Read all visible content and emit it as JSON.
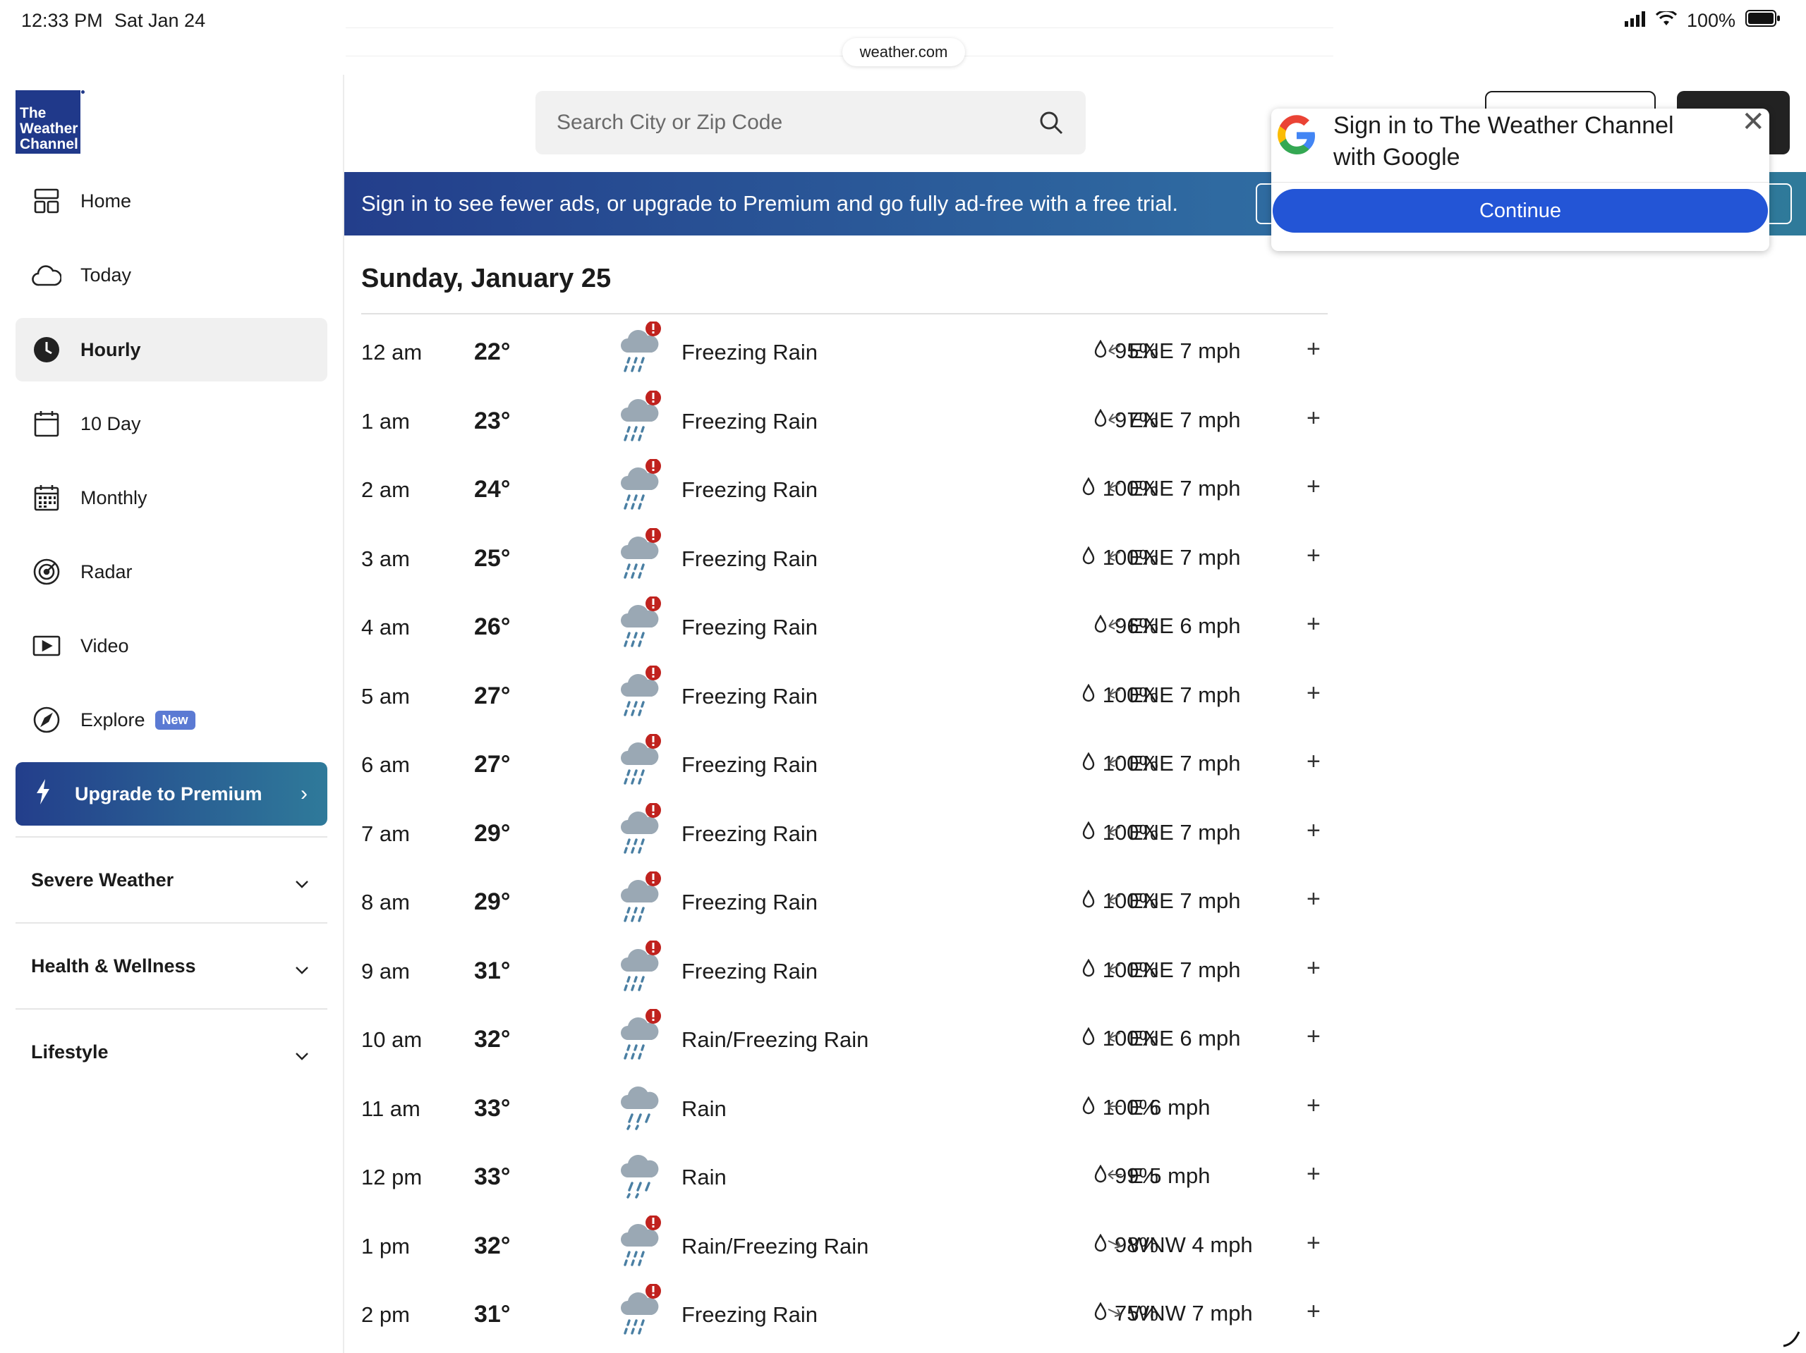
{
  "status_bar": {
    "time": "12:33 PM",
    "date": "Sat Jan 24",
    "battery": "100%"
  },
  "browser": {
    "url": "weather.com"
  },
  "logo": {
    "line1": "The",
    "line2": "Weather",
    "line3": "Channel"
  },
  "sidebar": {
    "items": [
      {
        "label": "Home",
        "icon": "home-grid-icon"
      },
      {
        "label": "Today",
        "icon": "cloud-icon"
      },
      {
        "label": "Hourly",
        "icon": "clock-icon",
        "active": true
      },
      {
        "label": "10 Day",
        "icon": "calendar-icon"
      },
      {
        "label": "Monthly",
        "icon": "calendar-grid-icon"
      },
      {
        "label": "Radar",
        "icon": "radar-icon"
      },
      {
        "label": "Video",
        "icon": "video-icon"
      },
      {
        "label": "Explore",
        "icon": "compass-icon",
        "badge": "New"
      }
    ],
    "premium_label": "Upgrade to Premium",
    "sections": [
      "Severe Weather",
      "Health & Wellness",
      "Lifestyle"
    ]
  },
  "header": {
    "search_placeholder": "Search City or Zip Code"
  },
  "banner": {
    "text": "Sign in to see fewer ads, or upgrade to Premium and go fully ad-free with a free trial."
  },
  "google_popup": {
    "title_line1": "Sign in to The Weather Channel",
    "title_line2": "with Google",
    "continue_label": "Continue"
  },
  "hourly": {
    "day": "Sunday, January 25",
    "rows": [
      {
        "time": "12 am",
        "temp": "22°",
        "condition": "Freezing Rain",
        "alert": true,
        "precip": "95%",
        "wind": "ENE 7 mph",
        "dir": "ene"
      },
      {
        "time": "1 am",
        "temp": "23°",
        "condition": "Freezing Rain",
        "alert": true,
        "precip": "97%",
        "wind": "ENE 7 mph",
        "dir": "ene"
      },
      {
        "time": "2 am",
        "temp": "24°",
        "condition": "Freezing Rain",
        "alert": true,
        "precip": "100%",
        "wind": "ENE 7 mph",
        "dir": "ene"
      },
      {
        "time": "3 am",
        "temp": "25°",
        "condition": "Freezing Rain",
        "alert": true,
        "precip": "100%",
        "wind": "ENE 7 mph",
        "dir": "ene"
      },
      {
        "time": "4 am",
        "temp": "26°",
        "condition": "Freezing Rain",
        "alert": true,
        "precip": "96%",
        "wind": "ENE 6 mph",
        "dir": "ene"
      },
      {
        "time": "5 am",
        "temp": "27°",
        "condition": "Freezing Rain",
        "alert": true,
        "precip": "100%",
        "wind": "ENE 7 mph",
        "dir": "ene"
      },
      {
        "time": "6 am",
        "temp": "27°",
        "condition": "Freezing Rain",
        "alert": true,
        "precip": "100%",
        "wind": "ENE 7 mph",
        "dir": "ene"
      },
      {
        "time": "7 am",
        "temp": "29°",
        "condition": "Freezing Rain",
        "alert": true,
        "precip": "100%",
        "wind": "ENE 7 mph",
        "dir": "ene"
      },
      {
        "time": "8 am",
        "temp": "29°",
        "condition": "Freezing Rain",
        "alert": true,
        "precip": "100%",
        "wind": "ENE 7 mph",
        "dir": "ene"
      },
      {
        "time": "9 am",
        "temp": "31°",
        "condition": "Freezing Rain",
        "alert": true,
        "precip": "100%",
        "wind": "ENE 7 mph",
        "dir": "ene"
      },
      {
        "time": "10 am",
        "temp": "32°",
        "condition": "Rain/Freezing Rain",
        "alert": true,
        "precip": "100%",
        "wind": "ENE 6 mph",
        "dir": "ene"
      },
      {
        "time": "11 am",
        "temp": "33°",
        "condition": "Rain",
        "alert": false,
        "precip": "100%",
        "wind": "E 6 mph",
        "dir": "e"
      },
      {
        "time": "12 pm",
        "temp": "33°",
        "condition": "Rain",
        "alert": false,
        "precip": "99%",
        "wind": "E 5 mph",
        "dir": "e"
      },
      {
        "time": "1 pm",
        "temp": "32°",
        "condition": "Rain/Freezing Rain",
        "alert": true,
        "precip": "98%",
        "wind": "WNW 4 mph",
        "dir": "wnw"
      },
      {
        "time": "2 pm",
        "temp": "31°",
        "condition": "Freezing Rain",
        "alert": true,
        "precip": "75%",
        "wind": "WNW 7 mph",
        "dir": "wnw"
      }
    ]
  },
  "colors": {
    "brand": "#20398a",
    "premium_start": "#233e8b",
    "premium_end": "#2f7a9a",
    "google_button": "#2355d6",
    "alert": "#c0221e"
  }
}
